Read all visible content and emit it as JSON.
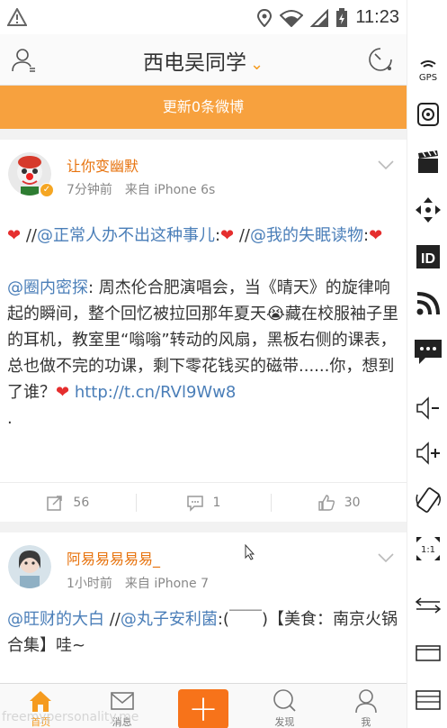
{
  "status_bar": {
    "time": "11:23"
  },
  "nav": {
    "title": "西电吴同学"
  },
  "banner": {
    "text": "更新0条微博"
  },
  "posts": [
    {
      "username": "让你变幽默",
      "time": "7分钟前",
      "source": "来自 iPhone 6s",
      "repost_count": "56",
      "comment_count": "1",
      "like_count": "30",
      "segments": [
        "❤",
        " //",
        "@正常人办不出这种事儿",
        ":",
        "❤",
        " //",
        "@我的失眠读物",
        ":",
        "❤",
        "@圈内密探",
        ": 周杰伦合肥演唱会，当《晴天》的旋律响起的瞬间，整个回忆被拉回那年夏天",
        "😭",
        "藏在校服袖子里的耳机，教室里“嗡嗡”转动的风扇，黑板右侧的课表，总也做不完的功课，剩下零花钱买的磁带......你，想到了谁？",
        "❤",
        " http://t.cn/RVl9Ww8",
        "."
      ]
    },
    {
      "username": "阿易易易易易_",
      "time": "1小时前",
      "source": "来自 iPhone 7",
      "segments": [
        "@旺财的大白",
        "  //",
        "@丸子安利菌",
        ":(￣￣)【美食：南京火锅合集】哇~"
      ]
    }
  ],
  "tabs": [
    {
      "label": "首页",
      "icon": "home-icon",
      "active": true
    },
    {
      "label": "消息",
      "icon": "message-icon"
    },
    {
      "label": "",
      "icon": "plus-icon"
    },
    {
      "label": "发现",
      "icon": "search-icon"
    },
    {
      "label": "我",
      "icon": "person-icon"
    }
  ],
  "watermark": "freemypersonality.me",
  "colors": {
    "accent": "#f59b1f",
    "banner": "#f7a13e",
    "link": "#4a7eb8",
    "username": "#e7730e",
    "compose": "#f7731a"
  },
  "toolbar_icons": [
    "gps-icon",
    "camera-icon",
    "clapper-icon",
    "dpad-icon",
    "id-icon",
    "rss-icon",
    "sms-icon",
    "volume-down-icon",
    "volume-up-icon",
    "rotate-icon",
    "scale-icon",
    "swap-icon",
    "window-icon",
    "list-icon"
  ]
}
